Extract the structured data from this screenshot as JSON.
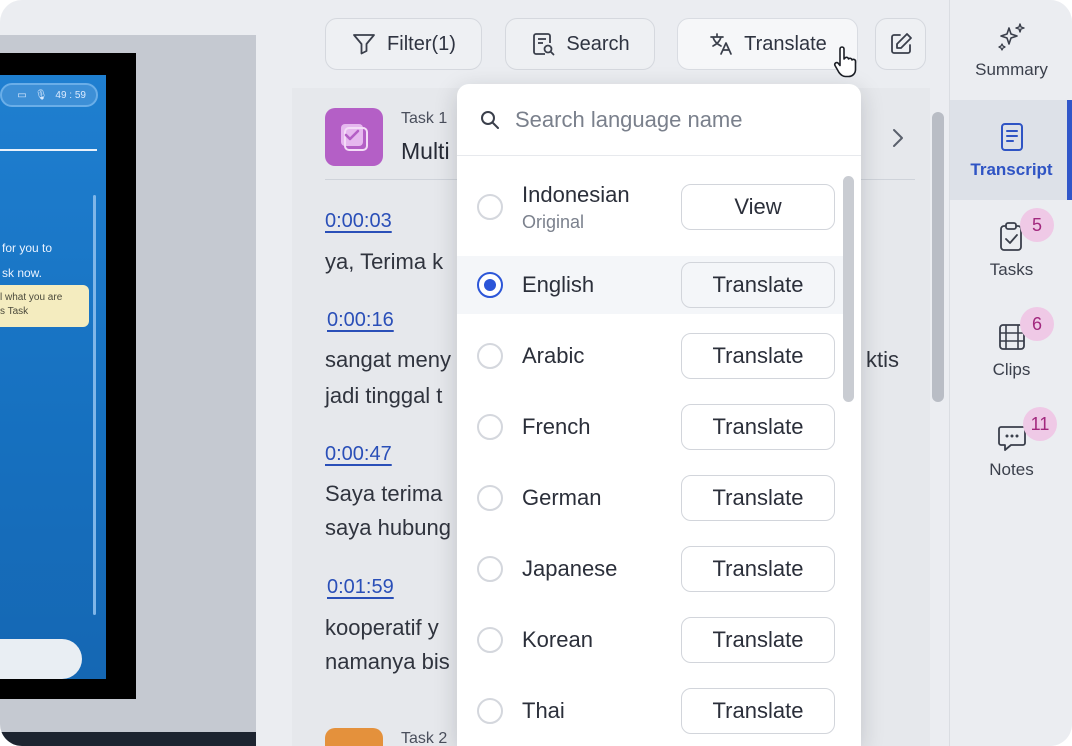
{
  "video": {
    "timer": "49 : 59",
    "text_line_1": "for you to",
    "text_line_2": "sk now.",
    "note_line_1": "l what you are",
    "note_line_2": "s Task"
  },
  "toolbar": {
    "filter_label": "Filter(1)",
    "search_label": "Search",
    "translate_label": "Translate"
  },
  "transcript": {
    "task1_label": "Task 1",
    "task1_title": "Multi",
    "task2_label": "Task 2",
    "segments": [
      {
        "time": "0:00:03",
        "line1": "ya, Terima k",
        "line2": ""
      },
      {
        "time": "0:00:16",
        "line1": "sangat meny",
        "line1_tail": "ktis",
        "line2": "jadi tinggal t"
      },
      {
        "time": "0:00:47",
        "line1": "Saya terima",
        "line2": "saya hubung"
      },
      {
        "time": "0:01:59",
        "line1": "kooperatif y",
        "line2": "namanya bis"
      }
    ]
  },
  "dropdown": {
    "search_placeholder": "Search language name",
    "languages": [
      {
        "name": "Indonesian",
        "sub": "Original",
        "action": "View",
        "selected": false
      },
      {
        "name": "English",
        "sub": "",
        "action": "Translate",
        "selected": true
      },
      {
        "name": "Arabic",
        "sub": "",
        "action": "Translate",
        "selected": false
      },
      {
        "name": "French",
        "sub": "",
        "action": "Translate",
        "selected": false
      },
      {
        "name": "German",
        "sub": "",
        "action": "Translate",
        "selected": false
      },
      {
        "name": "Japanese",
        "sub": "",
        "action": "Translate",
        "selected": false
      },
      {
        "name": "Korean",
        "sub": "",
        "action": "Translate",
        "selected": false
      },
      {
        "name": "Thai",
        "sub": "",
        "action": "Translate",
        "selected": false
      }
    ]
  },
  "sidebar": {
    "summary_label": "Summary",
    "transcript_label": "Transcript",
    "tasks_label": "Tasks",
    "tasks_count": "5",
    "clips_label": "Clips",
    "clips_count": "6",
    "notes_label": "Notes",
    "notes_count": "11"
  },
  "icons": {
    "filter": "filter-icon",
    "search": "search-doc-icon",
    "translate": "translate-icon",
    "edit": "edit-icon",
    "summary": "sparkles-icon",
    "transcript": "document-icon",
    "tasks": "clipboard-check-icon",
    "clips": "film-icon",
    "notes": "chat-bubble-icon"
  },
  "colors": {
    "accent": "#2c56d8",
    "task1_icon": "#b45fc6",
    "task2_icon": "#e4913c",
    "badge_bg": "#efc9e6",
    "badge_text": "#a2287e"
  }
}
